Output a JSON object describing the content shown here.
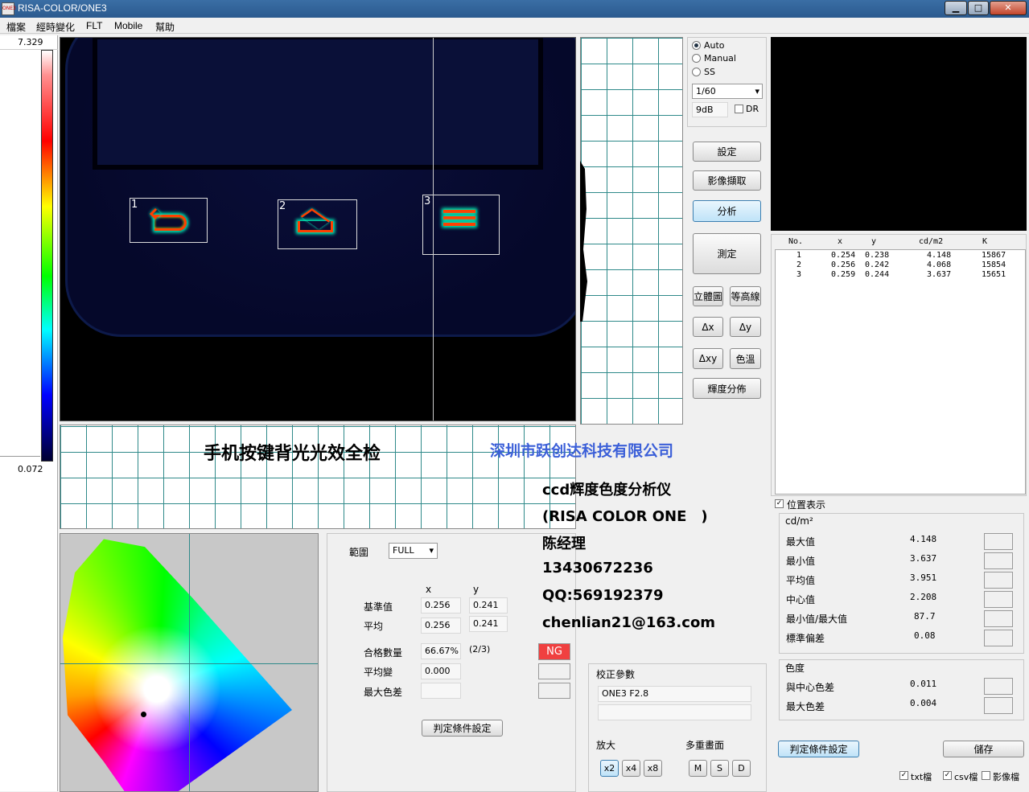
{
  "window": {
    "title": "RISA-COLOR/ONE3",
    "logo_text": "ONE3",
    "min": "▁",
    "max": "□",
    "close": "✕"
  },
  "menu": [
    "檔案",
    "經時變化",
    "FLT",
    "Mobile",
    "幫助"
  ],
  "scale": {
    "max": "7.329",
    "min": "0.072"
  },
  "regions": [
    {
      "label": "1"
    },
    {
      "label": "2"
    },
    {
      "label": "3"
    }
  ],
  "overlay": {
    "title_cn": "手机按键背光光效全检",
    "company": "深圳市跃创达科技有限公司",
    "line1": "ccd辉度色度分析仪",
    "line2": "(RISA COLOR ONE　)",
    "line3": "陈经理",
    "line4": "13430672236",
    "line5": "QQ:569192379",
    "line6": "chenlian21@163.com"
  },
  "exposure": {
    "modes": [
      "Auto",
      "Manual",
      "SS"
    ],
    "selected": "Auto",
    "shutter": "1/60",
    "gain": "9dB",
    "dr_label": "DR",
    "dr_checked": false
  },
  "buttons": {
    "settings": "設定",
    "capture": "影像擷取",
    "analyze": "分析",
    "measure": "測定",
    "3d": "立體圖",
    "contour": "等高線",
    "dx": "Δx",
    "dy": "Δy",
    "dxy": "Δxy",
    "color_temp": "色溫",
    "lum_dist": "輝度分佈"
  },
  "results": {
    "headers": [
      "No.",
      "x",
      "y",
      "cd/m2",
      "K"
    ],
    "rows": [
      [
        "1",
        "0.254",
        "0.238",
        "4.148",
        "15867"
      ],
      [
        "2",
        "0.256",
        "0.242",
        "4.068",
        "15854"
      ],
      [
        "3",
        "0.259",
        "0.244",
        "3.637",
        "15651"
      ]
    ]
  },
  "position_display": {
    "label": "位置表示",
    "checked": true
  },
  "stats": {
    "unit": "cd/m²",
    "rows": [
      {
        "label": "最大值",
        "value": "4.148"
      },
      {
        "label": "最小值",
        "value": "3.637"
      },
      {
        "label": "平均值",
        "value": "3.951"
      },
      {
        "label": "中心值",
        "value": "2.208"
      },
      {
        "label": "最小值/最大值",
        "value": "87.7"
      },
      {
        "label": "標準偏差",
        "value": "0.08"
      }
    ],
    "color_title": "色度",
    "color_rows": [
      {
        "label": "與中心色差",
        "value": "0.011"
      },
      {
        "label": "最大色差",
        "value": "0.004"
      }
    ]
  },
  "judge": {
    "range_label": "範圍",
    "range_value": "FULL",
    "col_x": "x",
    "col_y": "y",
    "ref_label": "基準值",
    "ref_x": "0.256",
    "ref_y": "0.241",
    "avg_label": "平均",
    "avg_x": "0.256",
    "avg_y": "0.241",
    "pass_label": "合格數量",
    "pass_pct": "66.67%",
    "pass_ratio": "(2/3)",
    "result": "NG",
    "avg_change_label": "平均變",
    "avg_change": "0.000",
    "max_diff_label": "最大色差",
    "button": "判定條件設定"
  },
  "calib": {
    "title": "校正參數",
    "value": "ONE3 F2.8"
  },
  "zoom": {
    "title": "放大",
    "options": [
      "x2",
      "x4",
      "x8"
    ],
    "selected": "x2"
  },
  "multi": {
    "title": "多重畫面",
    "options": [
      "M",
      "S",
      "D"
    ]
  },
  "bottom": {
    "judge_button": "判定條件設定",
    "save_button": "儲存",
    "txt": "txt檔",
    "csv": "csv檔",
    "img": "影像檔"
  },
  "colors": {
    "ng": "#f04040",
    "grid": "#2f8a8a",
    "company": "#3b5fd8"
  }
}
